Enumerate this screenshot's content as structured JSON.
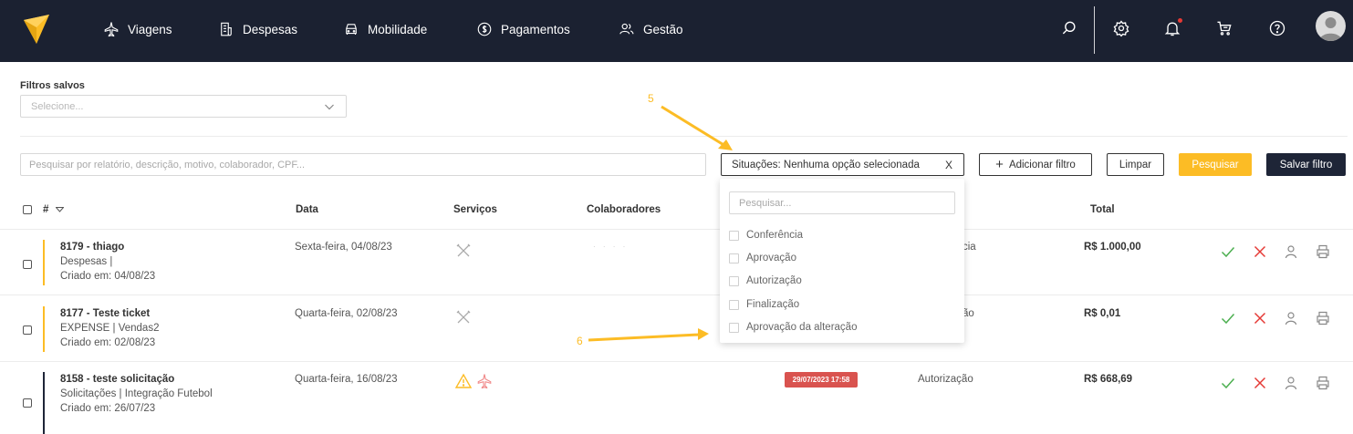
{
  "nav": {
    "items": [
      {
        "label": "Viagens",
        "icon": "airplane-icon"
      },
      {
        "label": "Despesas",
        "icon": "receipt-icon"
      },
      {
        "label": "Mobilidade",
        "icon": "car-icon"
      },
      {
        "label": "Pagamentos",
        "icon": "dollar-circle-icon"
      },
      {
        "label": "Gestão",
        "icon": "users-icon"
      }
    ],
    "right_icons": [
      "search-icon",
      "gear-icon",
      "bell-icon",
      "cart-icon",
      "help-icon",
      "avatar"
    ]
  },
  "saved_filters": {
    "label": "Filtros salvos",
    "placeholder": "Selecione..."
  },
  "filters": {
    "search_placeholder": "Pesquisar por relatório, descrição, motivo, colaborador, CPF...",
    "situations_label": "Situações: Nenhuma opção selecionada",
    "situations_clear": "X",
    "add_filter": "Adicionar filtro",
    "clear": "Limpar",
    "search": "Pesquisar",
    "save_filter": "Salvar filtro"
  },
  "dropdown": {
    "search_placeholder": "Pesquisar...",
    "options": [
      "Conferência",
      "Aprovação",
      "Autorização",
      "Finalização",
      "Aprovação da alteração"
    ]
  },
  "table": {
    "columns": [
      "#",
      "Data",
      "Serviços",
      "Colaboradores",
      "Total"
    ],
    "rows": [
      {
        "title": "8179 - thiago",
        "line2": "Despesas |",
        "line3": "Criado em: 04/08/23",
        "date": "Sexta-feira, 04/08/23",
        "status": "cia",
        "total": "R$ 1.000,00",
        "bar_color": "#fcbc25",
        "services": [
          "cutlery-icon"
        ]
      },
      {
        "title": "8177 - Teste ticket",
        "line2": "EXPENSE | Vendas2",
        "line3": "Criado em: 02/08/23",
        "date": "Quarta-feira, 02/08/23",
        "status": "ão",
        "total": "R$ 0,01",
        "bar_color": "#fcbc25",
        "services": [
          "cutlery-icon"
        ]
      },
      {
        "title": "8158 - teste solicitação",
        "line2": "Solicitações | Integração Futebol",
        "line3": "Criado em: 26/07/23",
        "date": "Quarta-feira, 16/08/23",
        "status": "Autorização",
        "total": "R$ 668,69",
        "bar_color": "#1e2537",
        "badge": "29/07/2023 17:58",
        "services": [
          "warning-icon",
          "airplane-icon"
        ]
      }
    ]
  },
  "annotations": {
    "a5": "5",
    "a6": "6",
    "color": "#fcbc25"
  },
  "colors": {
    "topbar": "#1b2131",
    "accent": "#fcbc25",
    "dark_button": "#1e2537",
    "approve": "#4caf50",
    "reject": "#e53935",
    "badge": "#d9534f"
  }
}
